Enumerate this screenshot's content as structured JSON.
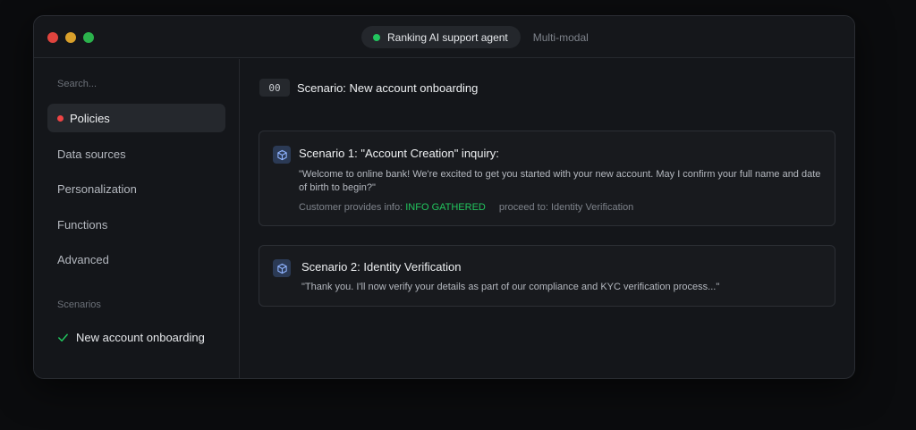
{
  "titlebar": {
    "active_tab": "Ranking AI support agent",
    "inactive_tab": "Multi-modal",
    "status_color": "#22c55e"
  },
  "sidebar": {
    "search_placeholder": "Search...",
    "items": [
      {
        "label": "Policies",
        "active": true,
        "indicator_color": "#ef4444"
      },
      {
        "label": "Data sources"
      },
      {
        "label": "Personalization"
      },
      {
        "label": "Functions"
      },
      {
        "label": "Advanced"
      }
    ],
    "scenarios_label": "Scenarios",
    "scenario_item": "New account onboarding"
  },
  "main": {
    "badge": "00",
    "title": "Scenario: New account onboarding",
    "scenarios": [
      {
        "title": "Scenario 1: \"Account Creation\" inquiry:",
        "quote": "\"Welcome to online bank! We're excited to get you started with your new account. May I confirm your full name and date of birth to begin?\"",
        "meta_prefix": "Customer provides info:",
        "meta_value": "INFO GATHERED",
        "meta_next": "proceed to: Identity Verification"
      },
      {
        "title": "Scenario 2: Identity Verification",
        "quote": "\"Thank you. I'll now verify your details as part of our compliance and KYC verification process...\""
      }
    ]
  }
}
